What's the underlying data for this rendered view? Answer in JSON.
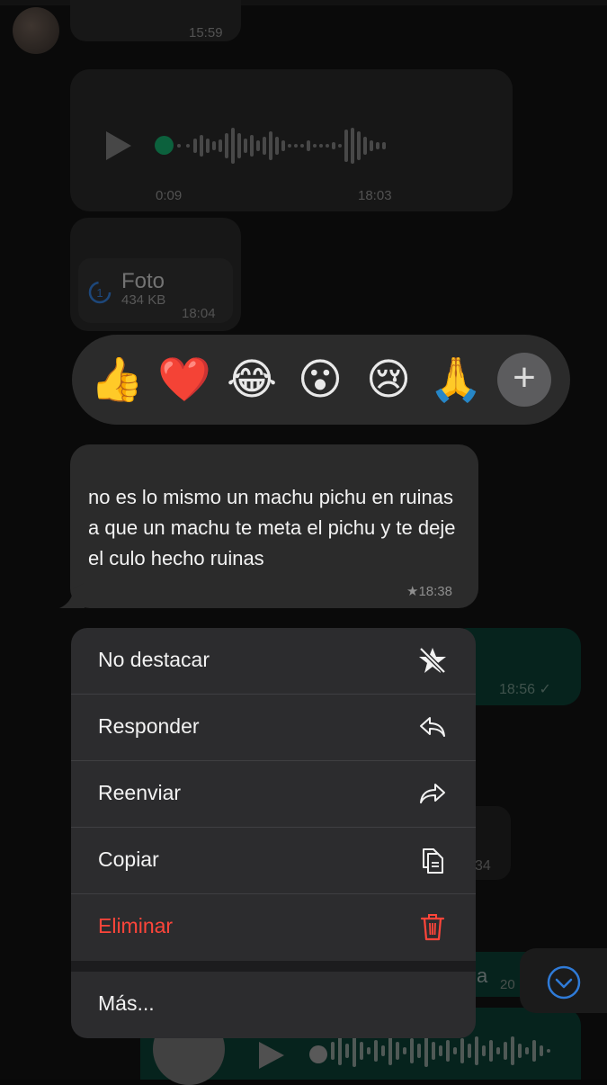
{
  "colors": {
    "background": "#070707",
    "bubble": "#232323",
    "menu": "#2c2c2e",
    "accent_green": "#0fa968",
    "danger": "#ff453a",
    "sent_bubble": "#05392e",
    "scroll_button_icon": "#2f7bd8"
  },
  "chat": {
    "top_message_time": "15:59",
    "voice_note": {
      "elapsed": "0:09",
      "time": "18:03",
      "icon": "play-icon"
    },
    "photo": {
      "label": "Foto",
      "size": "434 KB",
      "time": "18:04"
    },
    "reactions": [
      {
        "name": "thumbs-up",
        "glyph": "👍"
      },
      {
        "name": "red-heart",
        "glyph": "❤️"
      },
      {
        "name": "tears-of-joy",
        "glyph": "😂"
      },
      {
        "name": "surprised",
        "glyph": "😮"
      },
      {
        "name": "crying",
        "glyph": "😢"
      },
      {
        "name": "folded-hands",
        "glyph": "🙏"
      }
    ],
    "add_reaction": "+",
    "selected_message": {
      "text": "no es lo mismo un machu pichu en ruinas a que un machu te meta el pichu y te deje el culo hecho ruinas",
      "time": "★18:38"
    },
    "behind": {
      "sent_time_1": "18:56 ✓",
      "time_2": "34",
      "time_3": "a",
      "time_3b": "20"
    }
  },
  "context_menu": {
    "items": [
      {
        "label": "No destacar",
        "icon": "unstar-icon"
      },
      {
        "label": "Responder",
        "icon": "reply-icon"
      },
      {
        "label": "Reenviar",
        "icon": "forward-icon"
      },
      {
        "label": "Copiar",
        "icon": "copy-icon"
      },
      {
        "label": "Eliminar",
        "icon": "trash-icon"
      },
      {
        "label": "Más...",
        "icon": ""
      }
    ]
  }
}
